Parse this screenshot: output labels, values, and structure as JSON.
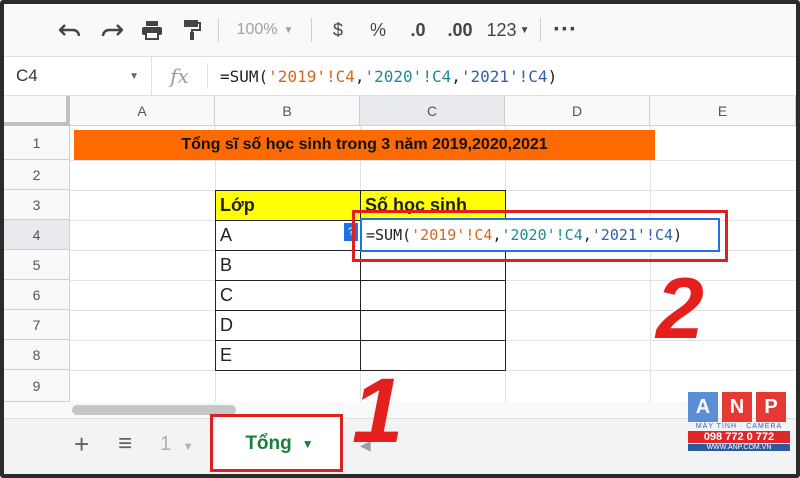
{
  "toolbar": {
    "undo_icon": "undo-icon",
    "redo_icon": "redo-icon",
    "print_icon": "print-icon",
    "paint_icon": "paint-format-icon",
    "zoom": "100%",
    "currency": "$",
    "percent": "%",
    "dec_decrease": ".0",
    "dec_increase": ".00",
    "format_more": "123",
    "more": "⋮"
  },
  "formula_bar": {
    "cell_ref": "C4",
    "fx": "fx",
    "f_prefix": "=SUM(",
    "f_ref1": "'2019'!C4",
    "f_comma1": ",",
    "f_ref2": "'2020'!C4",
    "f_comma2": ",",
    "f_ref3": "'2021'!C4",
    "f_suffix": ")"
  },
  "grid": {
    "columns": [
      "A",
      "B",
      "C",
      "D",
      "E"
    ],
    "rows": [
      "1",
      "2",
      "3",
      "4",
      "5",
      "6",
      "7",
      "8",
      "9"
    ]
  },
  "sheet": {
    "title": "Tổng sĩ số học sinh trong 3 năm 2019,2020,2021",
    "header_class": "Lớp",
    "header_count": "Số học sinh",
    "classes": [
      "A",
      "B",
      "C",
      "D",
      "E"
    ],
    "tooltip": "?"
  },
  "annotations": {
    "label_1": "1",
    "label_2": "2"
  },
  "tabs": {
    "add": "+",
    "list": "≡",
    "prev_sheet": "1",
    "active": "Tổng"
  },
  "watermark": {
    "letters": [
      "A",
      "N",
      "P"
    ],
    "sub": "MÁY TÍNH · CAMERA",
    "phone": "098 772 0 772",
    "web": "WWW.ANP.COM.VN"
  },
  "colors": {
    "title_bg": "#ff6a00",
    "header_bg": "#ffff00",
    "highlight_red": "#e02020",
    "selection_blue": "#1a73e8",
    "tab_green": "#188038"
  }
}
